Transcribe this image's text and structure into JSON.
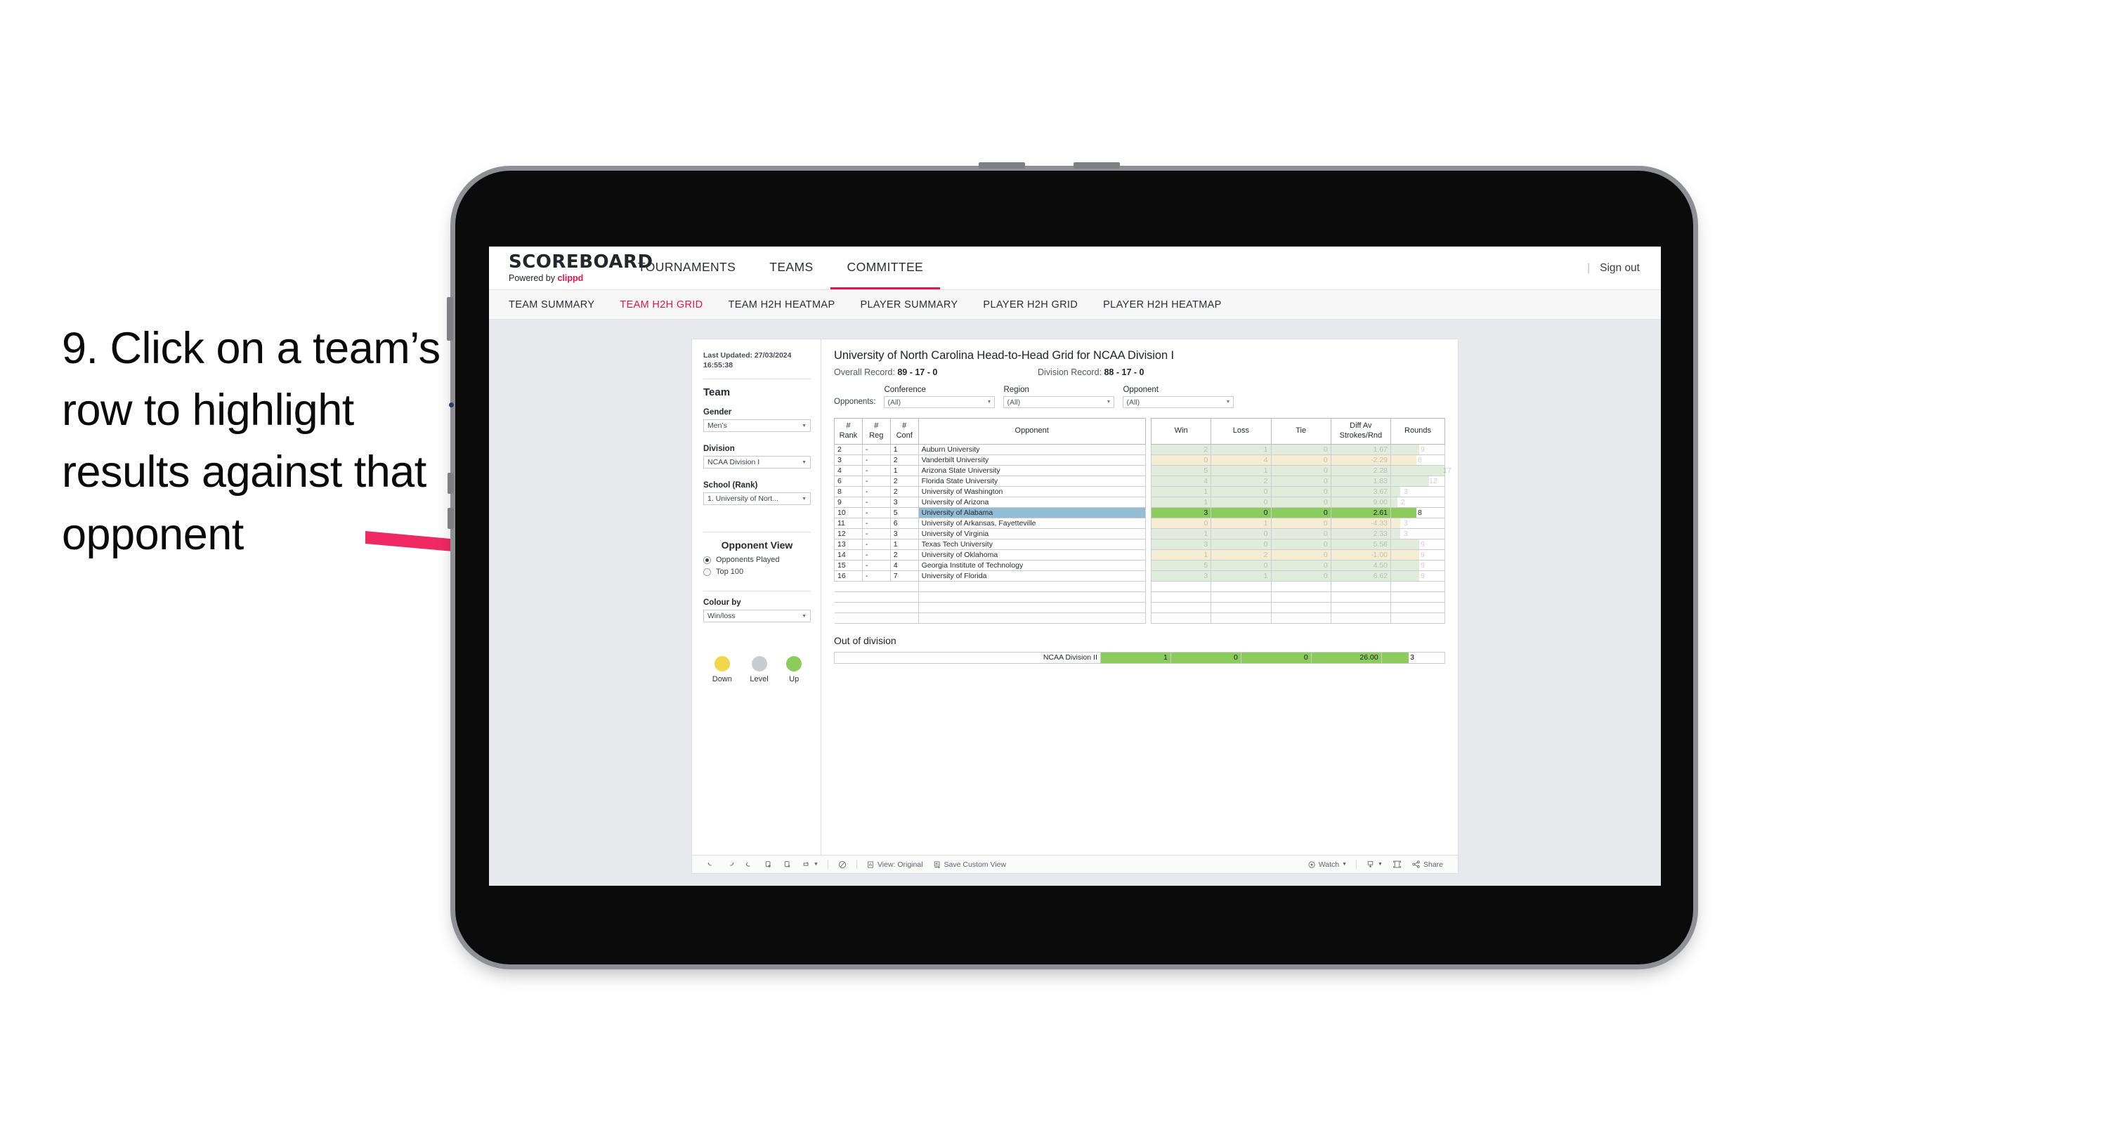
{
  "caption": {
    "text": "9. Click on a team’s row to highlight results against that opponent"
  },
  "topnav": {
    "logo": "SCOREBOARD",
    "powered_prefix": "Powered by ",
    "powered_brand": "clippd",
    "items": [
      {
        "label": "TOURNAMENTS",
        "active": false
      },
      {
        "label": "TEAMS",
        "active": false
      },
      {
        "label": "COMMITTEE",
        "active": true
      }
    ],
    "divider": "|",
    "signout": "Sign out"
  },
  "subnav": {
    "items": [
      {
        "label": "TEAM SUMMARY",
        "active": false
      },
      {
        "label": "TEAM H2H GRID",
        "active": true
      },
      {
        "label": "TEAM H2H HEATMAP",
        "active": false
      },
      {
        "label": "PLAYER SUMMARY",
        "active": false
      },
      {
        "label": "PLAYER H2H GRID",
        "active": false
      },
      {
        "label": "PLAYER H2H HEATMAP",
        "active": false
      }
    ]
  },
  "filters": {
    "last_updated": "Last Updated: 27/03/2024 16:55:38",
    "team_title": "Team",
    "gender": {
      "label": "Gender",
      "value": "Men’s"
    },
    "division": {
      "label": "Division",
      "value": "NCAA Division I"
    },
    "school": {
      "label": "School (Rank)",
      "value": "1. University of Nort..."
    },
    "opponent_view": {
      "title": "Opponent View",
      "options": [
        {
          "label": "Opponents Played",
          "selected": true
        },
        {
          "label": "Top 100",
          "selected": false
        }
      ]
    },
    "colour_by": {
      "label": "Colour by",
      "value": "Win/loss"
    },
    "legend": [
      {
        "label": "Down",
        "color": "#f2d64b"
      },
      {
        "label": "Level",
        "color": "#c8ccd0"
      },
      {
        "label": "Up",
        "color": "#8ccc5c"
      }
    ]
  },
  "main": {
    "title": "University of North Carolina Head-to-Head Grid for NCAA Division I",
    "overall_record_label": "Overall Record: ",
    "overall_record_value": "89 - 17 - 0",
    "division_record_label": "Division Record: ",
    "division_record_value": "88 - 17 - 0",
    "opponents_label": "Opponents:",
    "opponent_filters": [
      {
        "caption": "Conference",
        "value": "(All)"
      },
      {
        "caption": "Region",
        "value": "(All)"
      },
      {
        "caption": "Opponent",
        "value": "(All)"
      }
    ]
  },
  "chart_data": {
    "type": "table",
    "title": "University of North Carolina Head-to-Head Grid for NCAA Division I",
    "columns": [
      "# Rank",
      "# Reg",
      "# Conf",
      "Opponent",
      "Win",
      "Loss",
      "Tie",
      "Diff Av Strokes/Rnd",
      "Rounds"
    ],
    "column_headers_multiline": [
      {
        "l1": "#",
        "l2": "Rank"
      },
      {
        "l1": "#",
        "l2": "Reg"
      },
      {
        "l1": "#",
        "l2": "Conf"
      },
      {
        "l1": "Opponent",
        "l2": ""
      },
      {
        "l1": "Win",
        "l2": ""
      },
      {
        "l1": "Loss",
        "l2": ""
      },
      {
        "l1": "Tie",
        "l2": ""
      },
      {
        "l1": "Diff Av",
        "l2": "Strokes/Rnd"
      },
      {
        "l1": "Rounds",
        "l2": ""
      }
    ],
    "rounds_max": 17,
    "rows": [
      {
        "rank": "2",
        "reg": "-",
        "conf": "1",
        "opponent": "Auburn University",
        "win": "2",
        "loss": "1",
        "tie": "0",
        "diff": "1.67",
        "rounds": "9",
        "result": "up",
        "selected": false
      },
      {
        "rank": "3",
        "reg": "-",
        "conf": "2",
        "opponent": "Vanderbilt University",
        "win": "0",
        "loss": "4",
        "tie": "0",
        "diff": "-2.29",
        "rounds": "8",
        "result": "down",
        "selected": false
      },
      {
        "rank": "4",
        "reg": "-",
        "conf": "1",
        "opponent": "Arizona State University",
        "win": "5",
        "loss": "1",
        "tie": "0",
        "diff": "2.28",
        "rounds": "17",
        "result": "up",
        "selected": false
      },
      {
        "rank": "6",
        "reg": "-",
        "conf": "2",
        "opponent": "Florida State University",
        "win": "4",
        "loss": "2",
        "tie": "0",
        "diff": "1.83",
        "rounds": "12",
        "result": "up",
        "selected": false
      },
      {
        "rank": "8",
        "reg": "-",
        "conf": "2",
        "opponent": "University of Washington",
        "win": "1",
        "loss": "0",
        "tie": "0",
        "diff": "3.67",
        "rounds": "3",
        "result": "up",
        "selected": false
      },
      {
        "rank": "9",
        "reg": "-",
        "conf": "3",
        "opponent": "University of Arizona",
        "win": "1",
        "loss": "0",
        "tie": "0",
        "diff": "9.00",
        "rounds": "2",
        "result": "up",
        "selected": false
      },
      {
        "rank": "10",
        "reg": "-",
        "conf": "5",
        "opponent": "University of Alabama",
        "win": "3",
        "loss": "0",
        "tie": "0",
        "diff": "2.61",
        "rounds": "8",
        "result": "up",
        "selected": true
      },
      {
        "rank": "11",
        "reg": "-",
        "conf": "6",
        "opponent": "University of Arkansas, Fayetteville",
        "win": "0",
        "loss": "1",
        "tie": "0",
        "diff": "-4.33",
        "rounds": "3",
        "result": "down",
        "selected": false
      },
      {
        "rank": "12",
        "reg": "-",
        "conf": "3",
        "opponent": "University of Virginia",
        "win": "1",
        "loss": "0",
        "tie": "0",
        "diff": "2.33",
        "rounds": "3",
        "result": "up",
        "selected": false
      },
      {
        "rank": "13",
        "reg": "-",
        "conf": "1",
        "opponent": "Texas Tech University",
        "win": "3",
        "loss": "0",
        "tie": "0",
        "diff": "5.56",
        "rounds": "9",
        "result": "up",
        "selected": false
      },
      {
        "rank": "14",
        "reg": "-",
        "conf": "2",
        "opponent": "University of Oklahoma",
        "win": "1",
        "loss": "2",
        "tie": "0",
        "diff": "-1.00",
        "rounds": "9",
        "result": "down",
        "selected": false
      },
      {
        "rank": "15",
        "reg": "-",
        "conf": "4",
        "opponent": "Georgia Institute of Technology",
        "win": "5",
        "loss": "0",
        "tie": "0",
        "diff": "4.50",
        "rounds": "9",
        "result": "up",
        "selected": false
      },
      {
        "rank": "16",
        "reg": "-",
        "conf": "7",
        "opponent": "University of Florida",
        "win": "3",
        "loss": "1",
        "tie": "0",
        "diff": "6.62",
        "rounds": "9",
        "result": "up",
        "selected": false
      }
    ],
    "out_of_division": {
      "title": "Out of division",
      "rows": [
        {
          "label": "NCAA Division II",
          "win": "1",
          "loss": "0",
          "tie": "0",
          "diff": "26.00",
          "rounds": "3"
        }
      ]
    }
  },
  "toolbar": {
    "view_label": "View: Original",
    "save_label": "Save Custom View",
    "watch_label": "Watch",
    "share_label": "Share"
  },
  "colors": {
    "accent": "#e8134a",
    "up": "#8ccc5c",
    "down": "#f2d64b",
    "level": "#c8ccd0",
    "selected_row": "#92bdd4",
    "arrow": "#ef2a63"
  }
}
